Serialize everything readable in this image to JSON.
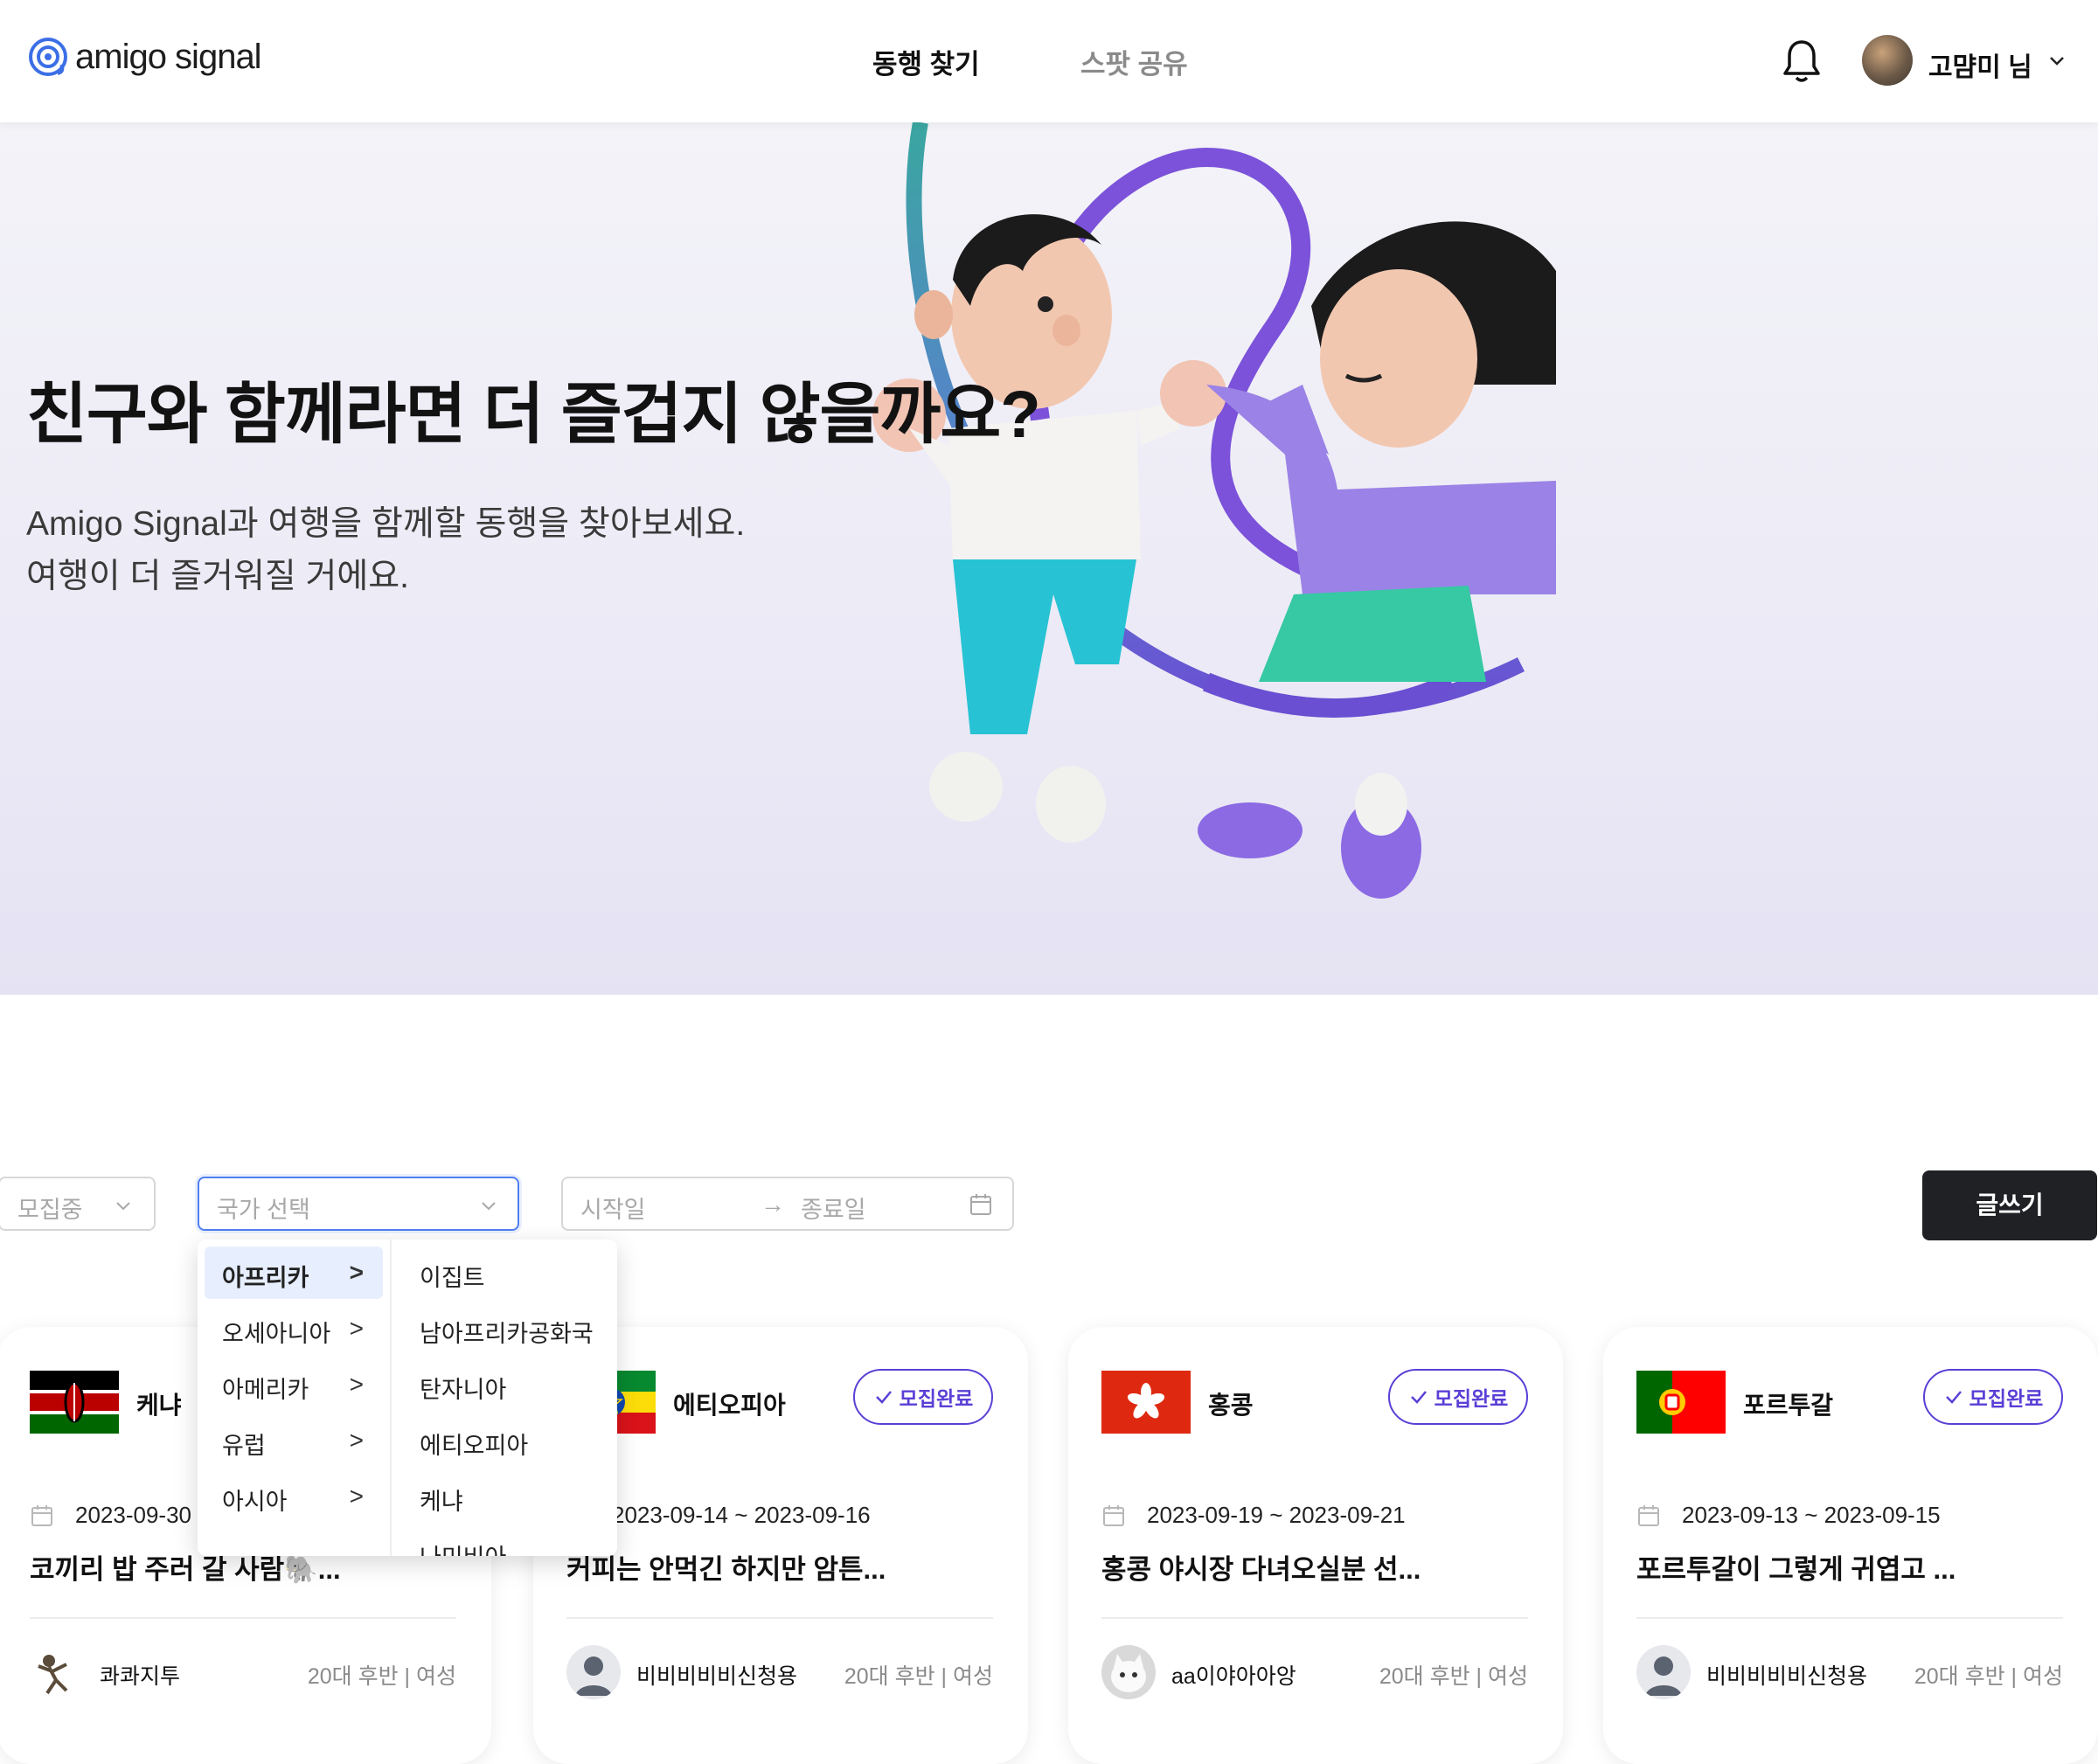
{
  "header": {
    "logo_text": "amigo signal",
    "nav": [
      "동행 찾기",
      "스팟 공유"
    ],
    "user_name": "고먐미 님"
  },
  "hero": {
    "title": "친구와 함께라면 더 즐겁지 않을까요?",
    "subtitle_line1": "Amigo Signal과 여행을 함께할 동행을 찾아보세요.",
    "subtitle_line2": "여행이 더 즐거워질 거에요."
  },
  "filters": {
    "status_placeholder": "모집중",
    "country_placeholder": "국가 선택",
    "start_placeholder": "시작일",
    "end_placeholder": "종료일",
    "write_button": "글쓰기"
  },
  "country_dropdown": {
    "regions": [
      "아프리카",
      "오세아니아",
      "아메리카",
      "유럽",
      "아시아"
    ],
    "selected_region": "아프리카",
    "countries": [
      "이집트",
      "남아프리카공화국",
      "탄자니아",
      "에티오피아",
      "케냐",
      "나미비아"
    ]
  },
  "cards": [
    {
      "country": "케냐",
      "dates": "2023-09-30",
      "title": "코끼리 밥 주러 갈 사람🐘...",
      "author": "콰콰지투",
      "author_meta": "20대 후반 | 여성",
      "badge": ""
    },
    {
      "country": "에티오피아",
      "dates": "2023-09-14 ~ 2023-09-16",
      "title": "커피는 안먹긴 하지만 암튼...",
      "author": "비비비비비신청용",
      "author_meta": "20대 후반 | 여성",
      "badge": "모집완료"
    },
    {
      "country": "홍콩",
      "dates": "2023-09-19 ~ 2023-09-21",
      "title": "홍콩 야시장 다녀오실분 선...",
      "author": "aa이야아아앙",
      "author_meta": "20대 후반 | 여성",
      "badge": "모집완료"
    },
    {
      "country": "포르투갈",
      "dates": "2023-09-13 ~ 2023-09-15",
      "title": "포르투갈이 그렇게 귀엽고 ...",
      "author": "비비비비비신청용",
      "author_meta": "20대 후반 | 여성",
      "badge": "모집완료"
    }
  ],
  "colors": {
    "accent": "#5b3fd6",
    "focus_border": "#4f7ff0",
    "primary_button": "#1f2124",
    "selected_menu_bg": "#e7efff"
  }
}
